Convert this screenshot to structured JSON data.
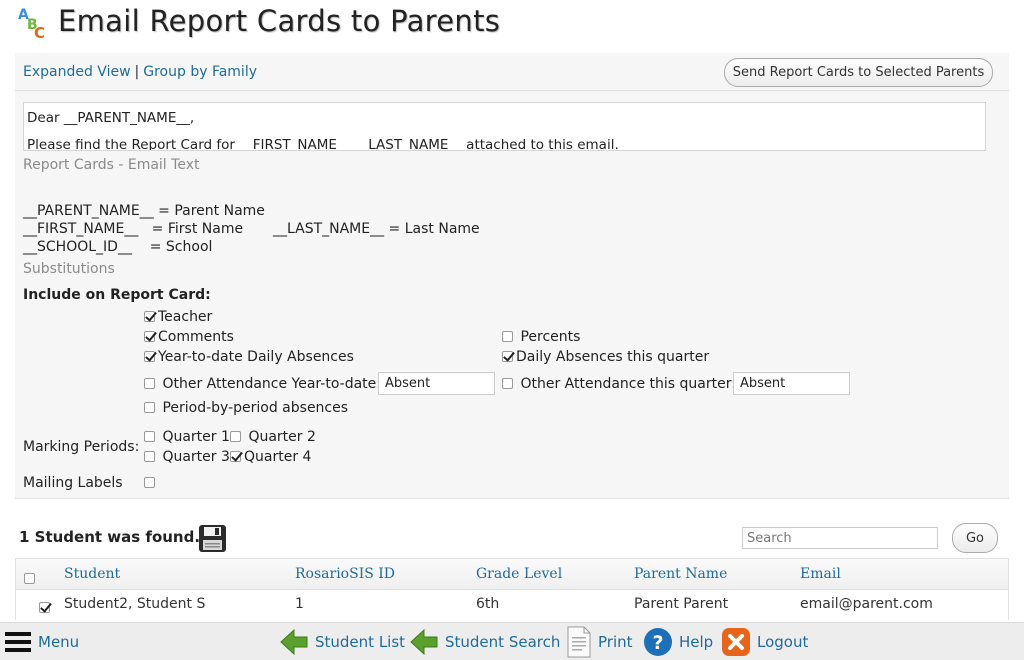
{
  "page": {
    "title": "Email Report Cards to Parents"
  },
  "toolbar": {
    "expanded_view": "Expanded View",
    "separator": "|",
    "group_by_family": "Group by Family",
    "send_button": "Send Report Cards to Selected Parents"
  },
  "email": {
    "line1": "Dear __PARENT_NAME__,",
    "line2": "Please find the Report Card for __FIRST_NAME__ __LAST_NAME__ attached to this email.",
    "legend": "Report Cards - Email Text"
  },
  "substitutions": {
    "row1": "__PARENT_NAME__ = Parent Name",
    "row2a": "__FIRST_NAME__   = First Name",
    "row2b": "__LAST_NAME__ = Last Name",
    "row3": "__SCHOOL_ID__    = School",
    "legend": "Substitutions"
  },
  "include": {
    "heading": "Include on Report Card:",
    "teacher": "Teacher",
    "comments": "Comments",
    "percents": "Percents",
    "ytd_daily_absences": "Year-to-date Daily Absences",
    "daily_absences_quarter": "Daily Absences this quarter",
    "other_att_ytd": "Other Attendance Year-to-date:",
    "other_att_ytd_value": "Absent",
    "other_att_quarter": "Other Attendance this quarter:",
    "other_att_quarter_value": "Absent",
    "period_absences": "Period-by-period absences"
  },
  "marking_periods": {
    "label": "Marking Periods:",
    "q1": "Quarter 1",
    "q2": "Quarter 2",
    "q3": "Quarter 3",
    "q4": "Quarter 4"
  },
  "mailing_labels": {
    "label": "Mailing Labels"
  },
  "results": {
    "found": "1 Student was found.",
    "search_placeholder": "Search",
    "go": "Go"
  },
  "table": {
    "headers": [
      "Student",
      "RosarioSIS ID",
      "Grade Level",
      "Parent Name",
      "Email"
    ],
    "rows": [
      {
        "student": "Student2, Student S",
        "id": "1",
        "grade": "6th",
        "parent": "Parent Parent",
        "email": "email@parent.com"
      }
    ]
  },
  "bottom_bar": {
    "menu": "Menu",
    "student_list": "Student List",
    "student_search": "Student Search",
    "print": "Print",
    "help": "Help",
    "logout": "Logout"
  },
  "colors": {
    "link": "#1f6b99",
    "arrow_green": "#5aa02c",
    "help_blue": "#1d6fb8",
    "logout_orange": "#e8641b"
  },
  "icons": [
    "abc-icon",
    "save-icon",
    "menu-icon",
    "back-arrow-icon",
    "print-icon",
    "help-icon",
    "logout-icon"
  ]
}
